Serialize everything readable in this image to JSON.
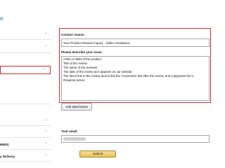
{
  "page": {
    "title": "e"
  },
  "sidebar": {
    "items": [
      {
        "label": "",
        "chevron": "chevron-right"
      },
      {
        "label": "",
        "chevron": "chevron-right"
      },
      {
        "label": "",
        "chevron": "chevron-up"
      },
      {
        "label": "",
        "chevron": ""
      },
      {
        "label": "",
        "chevron": "chevron-right"
      },
      {
        "label": "",
        "chevron": "chevron-right"
      },
      {
        "label": "MWS)",
        "chevron": "chevron-right"
      },
      {
        "label": "y Delivery",
        "chevron": "chevron-right"
      }
    ]
  },
  "form": {
    "contact_reason": {
      "label": "Contact reason",
      "selected": "Your Product Review Inquiry - Seller Assistance"
    },
    "issue": {
      "label": "Please describe your issue",
      "lines": [
        "ASIN or ISBN of the product:",
        "Title of the review:",
        "The name of the reviewer:",
        "The date of the review as it appears on our website:",
        "The direct link to the review /post (click the 'Comments' link after the review, and copy/paste the U",
        "Required action:"
      ]
    },
    "attach_label": "Add attachment",
    "email": {
      "label": "Your email"
    },
    "submit_label": "Submit"
  },
  "icons": {
    "expanded": "chevron-up-icon",
    "collapsed": "chevron-right-icon"
  },
  "colors": {
    "highlight": "#d9272e",
    "link": "#1a6fb5",
    "submit": "#f0c14b"
  }
}
